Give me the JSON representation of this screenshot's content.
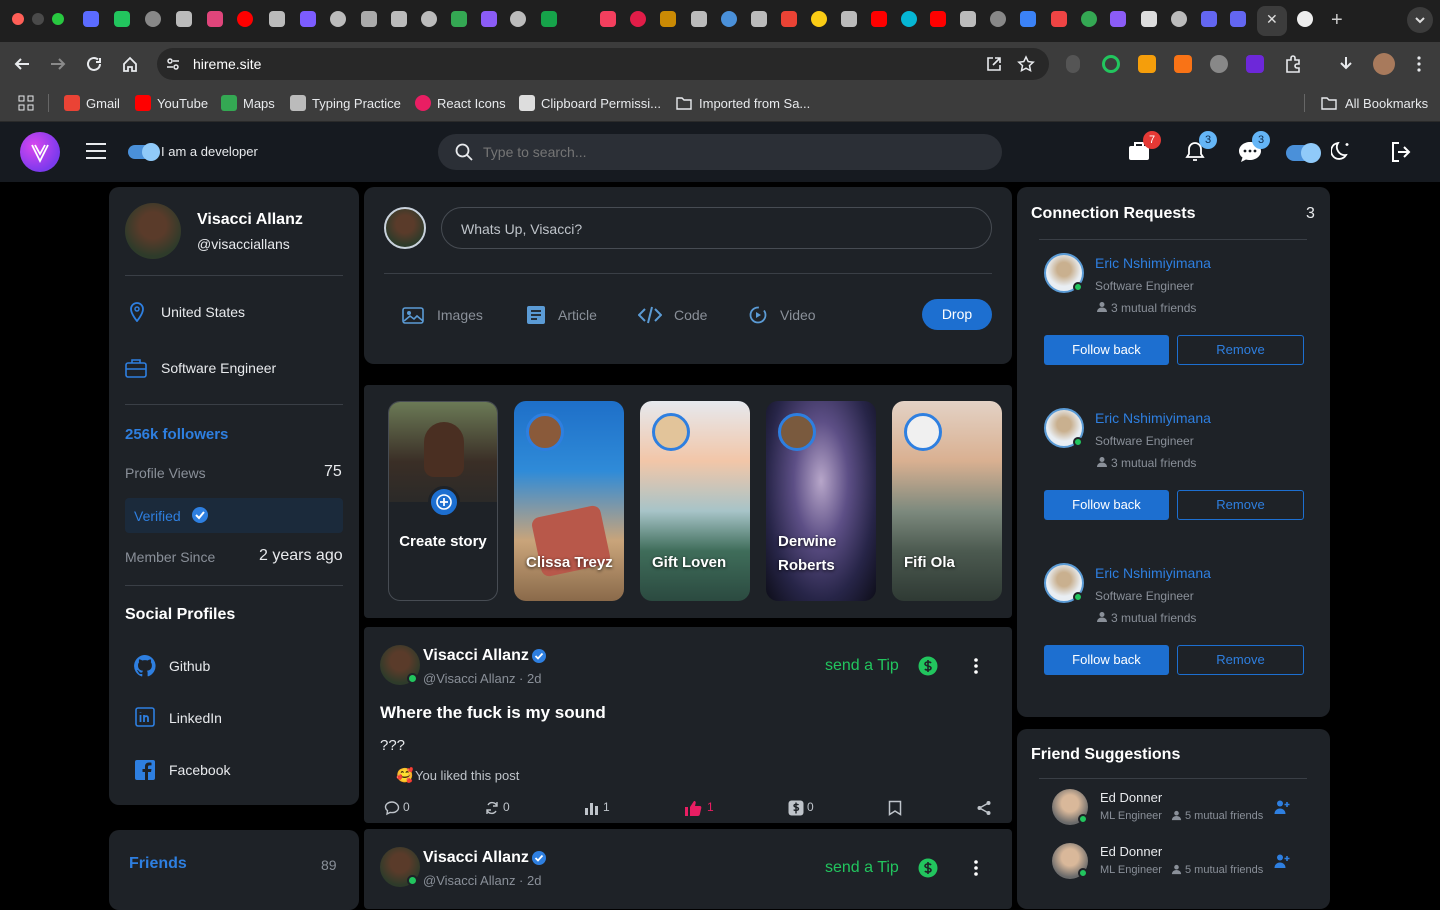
{
  "browser": {
    "url": "hireme.site",
    "bookmarks": [
      "Gmail",
      "YouTube",
      "Maps",
      "Typing Practice",
      "React Icons",
      "Clipboard Permissi...",
      "Imported from Sa..."
    ],
    "all_bookmarks": "All Bookmarks"
  },
  "header": {
    "developer_toggle_label": "I am a developer",
    "search_placeholder": "Type to search...",
    "cart_count": "7",
    "notifications_count": "3",
    "messages_count": "3"
  },
  "profile": {
    "name": "Visacci Allanz",
    "handle": "@visacciallans",
    "location": "United States",
    "job": "Software Engineer",
    "followers": "256k followers",
    "profile_views_label": "Profile Views",
    "profile_views": "75",
    "verified_label": "Verified",
    "member_since_label": "Member Since",
    "member_since": "2 years ago",
    "social_title": "Social Profiles",
    "socials": [
      "Github",
      "LinkedIn",
      "Facebook"
    ]
  },
  "friends": {
    "title": "Friends",
    "count": "89"
  },
  "composer": {
    "placeholder": "Whats Up, Visacci?",
    "actions": [
      "Images",
      "Article",
      "Code",
      "Video"
    ],
    "drop_label": "Drop"
  },
  "stories": {
    "create_label": "Create story",
    "items": [
      "Clissa Treyz",
      "Gift Loven",
      "Derwine Roberts",
      "Fifi Ola"
    ]
  },
  "posts": [
    {
      "author": "Visacci Allanz",
      "meta": "@Visacci Allanz · 2d",
      "tip": "send a Tip",
      "title": "Where the fuck is my sound",
      "body": "???",
      "liked_text": "You liked this post",
      "stats": {
        "comments": "0",
        "reposts": "0",
        "views": "1",
        "likes": "1",
        "tips": "0"
      }
    },
    {
      "author": "Visacci Allanz",
      "meta": "@Visacci Allanz · 2d",
      "tip": "send a Tip"
    }
  ],
  "connection_requests": {
    "title": "Connection Requests",
    "count": "3",
    "items": [
      {
        "name": "Eric Nshimiyimana",
        "role": "Software Engineer",
        "mutual": "3 mutual friends"
      },
      {
        "name": "Eric Nshimiyimana",
        "role": "Software Engineer",
        "mutual": "3 mutual friends"
      },
      {
        "name": "Eric Nshimiyimana",
        "role": "Software Engineer",
        "mutual": "3 mutual friends"
      }
    ],
    "follow_label": "Follow back",
    "remove_label": "Remove"
  },
  "friend_suggestions": {
    "title": "Friend Suggestions",
    "items": [
      {
        "name": "Ed Donner",
        "role": "ML Engineer",
        "mutual": "5 mutual friends"
      },
      {
        "name": "Ed Donner",
        "role": "ML Engineer",
        "mutual": "5 mutual friends"
      }
    ]
  },
  "colors": {
    "accent": "#1d6fd0",
    "link": "#2e7fe0",
    "tip_green": "#22c55e",
    "like_pink": "#e91e63",
    "card": "#1e2227"
  },
  "icons": [
    "search-icon",
    "menu-icon",
    "briefcase-icon",
    "bell-icon",
    "chat-icon",
    "moon-icon",
    "logout-icon",
    "location-pin-icon",
    "github-icon",
    "linkedin-icon",
    "facebook-icon",
    "verified-icon",
    "image-icon",
    "article-icon",
    "code-icon",
    "video-icon",
    "dollar-icon",
    "more-vert-icon",
    "comment-icon",
    "repost-icon",
    "bar-chart-icon",
    "thumb-up-icon",
    "bookmark-icon",
    "share-icon",
    "add-user-icon",
    "people-icon"
  ]
}
